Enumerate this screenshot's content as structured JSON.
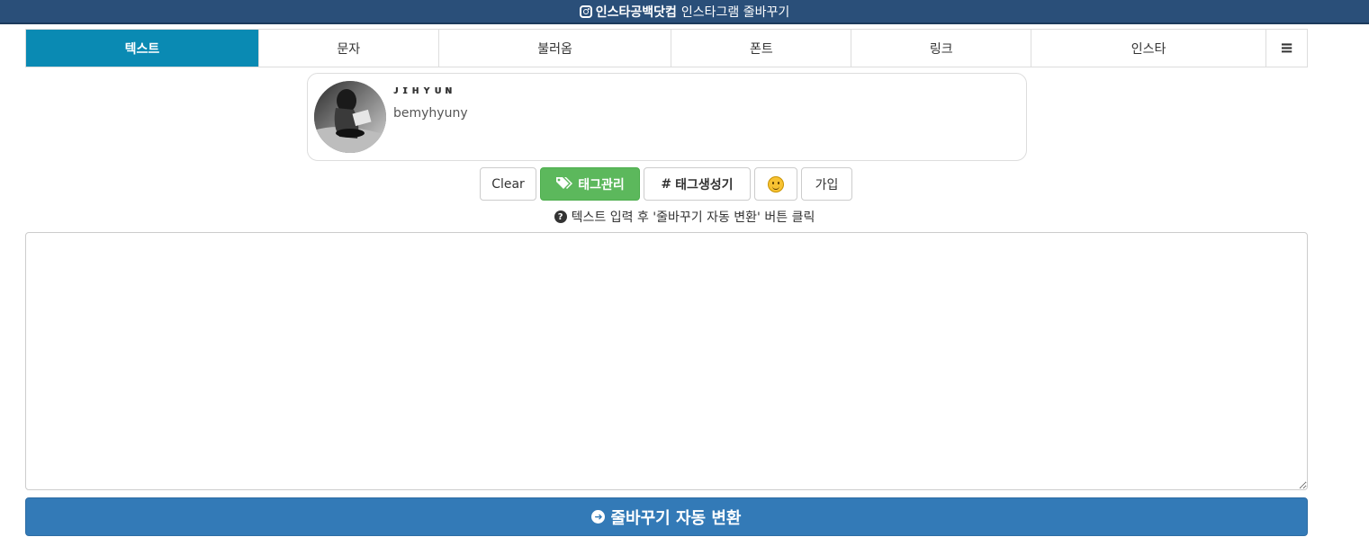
{
  "header": {
    "brand": "인스타공백닷컴",
    "title": "인스타그램 줄바꾸기"
  },
  "tabs": [
    {
      "label": "텍스트",
      "active": true
    },
    {
      "label": "문자"
    },
    {
      "label": "불러옴"
    },
    {
      "label": "폰트"
    },
    {
      "label": "링크"
    },
    {
      "label": "인스타"
    }
  ],
  "menu_icon": "≡",
  "profile": {
    "name": "ᴊɪʜʏᴜɴ",
    "username": "bemyhyuny"
  },
  "buttons": {
    "clear": "Clear",
    "tag_manage": "태그관리",
    "tag_generator": "태그생성기",
    "join": "가입"
  },
  "help_text": "텍스트 입력 후 '줄바꾸기 자동 변환' 버튼 클릭",
  "textarea": {
    "value": ""
  },
  "convert_button": "줄바꾸기 자동 변환",
  "colors": {
    "topbar": "#2a4f79",
    "active_tab": "#0a8ab3",
    "green_button": "#5cb85c",
    "primary_button": "#337ab7"
  }
}
